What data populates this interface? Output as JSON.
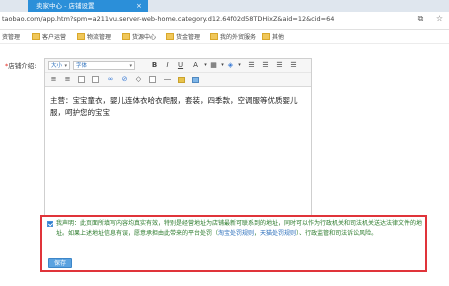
{
  "browser": {
    "tab_title": "卖家中心 - 店铺设置",
    "tab_close": "×",
    "address": "taobao.com/app.htm?spm=a211vu.server-web-home.category.d12.64f02d58TDHixZ&aid=12&cid=64",
    "bookmarks": [
      "资管理",
      "客户运营",
      "物流管理",
      "货源中心",
      "货金管理",
      "我的外贸服务",
      "其他"
    ]
  },
  "form": {
    "label_required": "*",
    "label": "店铺介绍:"
  },
  "editor": {
    "toolbar1": {
      "size_select": "大小",
      "font_select": "字体",
      "bold": "B",
      "italic": "I",
      "underline": "U",
      "font_color": "A"
    },
    "content": "主营：宝宝童衣，婴儿连体衣哈衣爬服，套装，四季款，空调服等优质婴儿服，呵护您的宝宝"
  },
  "declaration": {
    "text_main": "我声明：此页面所填写内容均真实有效，特别是经营地址为店铺最新可联系到的地址，同时可以作为行政机关和司法机关送达法律文件的地址。如果上述地址信息有误，愿意承担由此带来的平台处罚（",
    "link1": "淘宝处罚规则",
    "sep": "，",
    "link2": "天猫处罚规则",
    "text_tail": "）、行政监管和司法诉讼风险。",
    "save_label": "保存"
  }
}
